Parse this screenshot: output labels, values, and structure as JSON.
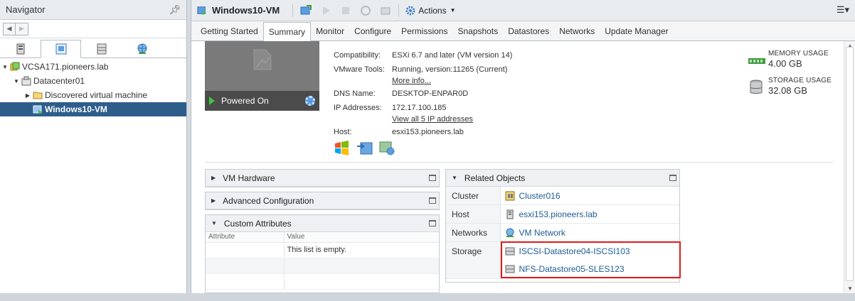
{
  "navigator": {
    "title": "Navigator",
    "tree": [
      {
        "label": "VCSA171.pioneers.lab",
        "level": 0
      },
      {
        "label": "Datacenter01",
        "level": 1
      },
      {
        "label": "Discovered virtual machine",
        "level": 2
      },
      {
        "label": "Windows10-VM",
        "level": 2
      }
    ]
  },
  "toolbar": {
    "vm_title": "Windows10-VM",
    "actions_label": "Actions"
  },
  "tabs": [
    "Getting Started",
    "Summary",
    "Monitor",
    "Configure",
    "Permissions",
    "Snapshots",
    "Datastores",
    "Networks",
    "Update Manager"
  ],
  "summary": {
    "power_state": "Powered On",
    "props": {
      "compatibility_key": "Compatibility:",
      "compatibility_val": "ESXi 6.7 and later (VM version 14)",
      "tools_key": "VMware Tools:",
      "tools_val": "Running, version:11265 (Current)",
      "tools_link": "More info...",
      "dns_key": "DNS Name:",
      "dns_val": "DESKTOP-ENPAR0D",
      "ip_key": "IP Addresses:",
      "ip_val": "172.17.100.185",
      "ip_link": "View all 5 IP addresses",
      "host_key": "Host:",
      "host_val": "esxi153.pioneers.lab"
    },
    "usage": {
      "memory_label": "MEMORY USAGE",
      "memory_val": "4.00 GB",
      "storage_label": "STORAGE USAGE",
      "storage_val": "32.08 GB"
    }
  },
  "portlets": {
    "vm_hardware": "VM Hardware",
    "advanced_config": "Advanced Configuration",
    "custom_attributes": {
      "title": "Custom Attributes",
      "col_attribute": "Attribute",
      "col_value": "Value",
      "empty_text": "This list is empty."
    },
    "related_objects": {
      "title": "Related Objects",
      "cluster_key": "Cluster",
      "cluster_val": "Cluster016",
      "host_key": "Host",
      "host_val": "esxi153.pioneers.lab",
      "networks_key": "Networks",
      "networks_val": "VM Network",
      "storage_key": "Storage",
      "storage_vals": [
        "ISCSI-Datastore04-ISCSI103",
        "NFS-Datastore05-SLES123"
      ]
    }
  },
  "colors": {
    "selection": "#2d5d8b",
    "link": "#1d5c95",
    "highlight": "#dd1c1c",
    "power_on": "#3ec23e"
  }
}
